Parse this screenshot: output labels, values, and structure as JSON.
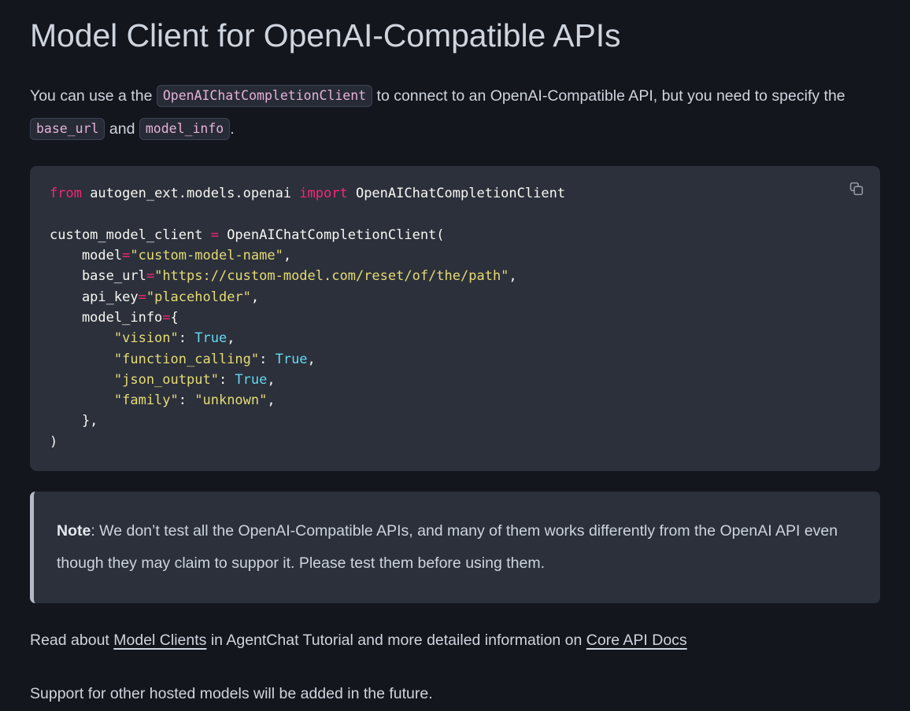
{
  "page": {
    "title": "Model Client for OpenAI-Compatible APIs",
    "background_color": "#14161d",
    "text_color": "#ced4de"
  },
  "intro": {
    "seg1": "You can use a the ",
    "code1": "OpenAIChatCompletionClient",
    "seg2": " to connect to an OpenAI-Compatible API, but you need to specify the ",
    "code2": "base_url",
    "seg3": " and ",
    "code3": "model_info",
    "seg4": "."
  },
  "code_block": {
    "language": "python",
    "copy_icon": "copy-icon",
    "background_color": "#2b303b",
    "lines": {
      "l1_kw_from": "from",
      "l1_module": " autogen_ext.models.openai ",
      "l1_kw_import": "import",
      "l1_symbol": " OpenAIChatCompletionClient",
      "l3_name": "custom_model_client ",
      "l3_op": "=",
      "l3_call": " OpenAIChatCompletionClient(",
      "l4_key": "    model",
      "l4_op": "=",
      "l4_val": "\"custom-model-name\"",
      "l4_comma": ",",
      "l5_key": "    base_url",
      "l5_op": "=",
      "l5_val": "\"https://custom-model.com/reset/of/the/path\"",
      "l5_comma": ",",
      "l6_key": "    api_key",
      "l6_op": "=",
      "l6_val": "\"placeholder\"",
      "l6_comma": ",",
      "l7_key": "    model_info",
      "l7_op": "=",
      "l7_brace": "{",
      "l8_key": "        \"vision\"",
      "l8_colon": ": ",
      "l8_val": "True",
      "l8_comma": ",",
      "l9_key": "        \"function_calling\"",
      "l9_colon": ": ",
      "l9_val": "True",
      "l9_comma": ",",
      "l10_key": "        \"json_output\"",
      "l10_colon": ": ",
      "l10_val": "True",
      "l10_comma": ",",
      "l11_key": "        \"family\"",
      "l11_colon": ": ",
      "l11_val": "\"unknown\"",
      "l11_comma": ",",
      "l12_close": "    },",
      "l13_close": ")"
    }
  },
  "note": {
    "label": "Note",
    "body": ": We don’t test all the OpenAI-Compatible APIs, and many of them works differently from the OpenAI API even though they may claim to suppor it. Please test them before using them.",
    "accent_color": "#b3bac6"
  },
  "links_paragraph": {
    "seg1": "Read about ",
    "link1": "Model Clients",
    "seg2": " in AgentChat Tutorial and more detailed information on ",
    "link2": "Core API Docs"
  },
  "tail_paragraph": {
    "text": "Support for other hosted models will be added in the future."
  }
}
